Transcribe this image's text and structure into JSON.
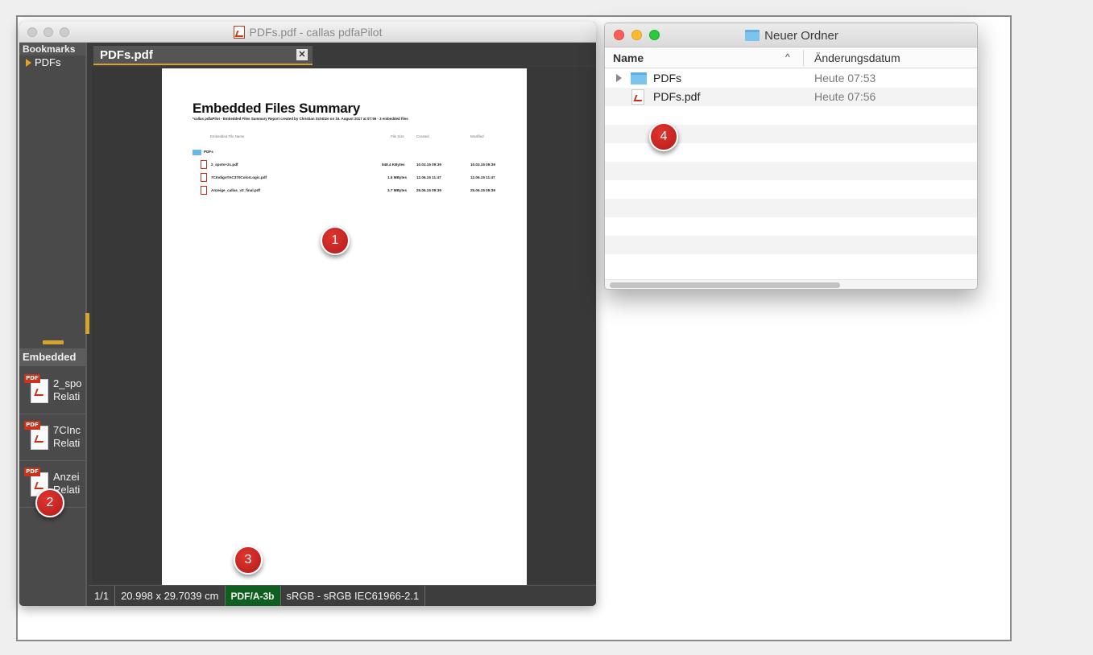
{
  "pilot_window": {
    "title": "PDFs.pdf - callas pdfaPilot",
    "sidebar": {
      "bookmarks_header": "Bookmarks",
      "bookmark_items": [
        {
          "label": "PDFs"
        }
      ],
      "embedded_header": "Embedded",
      "embedded_items": [
        {
          "tag": "PDF",
          "name": "2_spo",
          "sub": "Relati"
        },
        {
          "tag": "PDF",
          "name": "7CInc",
          "sub": "Relati"
        },
        {
          "tag": "PDF",
          "name": "Anzei",
          "sub": "Relati"
        }
      ]
    },
    "tab": {
      "label": "PDFs.pdf",
      "close": "✕"
    },
    "page": {
      "title": "Embedded Files Summary",
      "subtitle": "*callas pdfaPilot - Embedded Files Summary Report created by Christian Schütze on 16. August 2017 at 07:56 - 3 embedded files",
      "headers": {
        "name": "Embedded File Name",
        "size": "File Size",
        "created": "Created",
        "modified": "Modified"
      },
      "folder_label": "PDFs",
      "rows": [
        {
          "name": "2_spots+2c.pdf",
          "size": "548.4 KBytes",
          "created": "10.03.15 09:39",
          "modified": "10.03.15 09:39"
        },
        {
          "name": "7CIndigoTAC370ColorLogic.pdf",
          "size": "1.6 MBytes",
          "created": "12.06.15 11:47",
          "modified": "12.06.15 11:47"
        },
        {
          "name": "Anzeige_callas_v3_final.pdf",
          "size": "3.7 MBytes",
          "created": "25.06.15 09:39",
          "modified": "25.06.15 09:39"
        }
      ]
    },
    "statusbar": {
      "page_count": "1/1",
      "dimensions": "20.998 x 29.7039 cm",
      "pdfa": "PDF/A-3b",
      "color_profile": "sRGB - sRGB IEC61966-2.1"
    }
  },
  "finder_window": {
    "title": "Neuer Ordner",
    "columns": {
      "name": "Name",
      "sort_indicator": "^",
      "date": "Änderungsdatum"
    },
    "rows": [
      {
        "name": "PDFs",
        "date": "Heute 07:53",
        "icon": "folder-icon"
      },
      {
        "name": "PDFs.pdf",
        "date": "Heute 07:56",
        "icon": "pdf-file-icon"
      }
    ]
  },
  "callouts": {
    "c1": "1",
    "c2": "2",
    "c3": "3",
    "c4": "4"
  },
  "colors": {
    "accent_orange": "#e8a021",
    "pdfa_green": "#0f5f20",
    "callout_red": "#c8231f",
    "mac_red": "#fc5f57",
    "mac_yellow": "#fdbc2e",
    "mac_green": "#2ac940"
  }
}
